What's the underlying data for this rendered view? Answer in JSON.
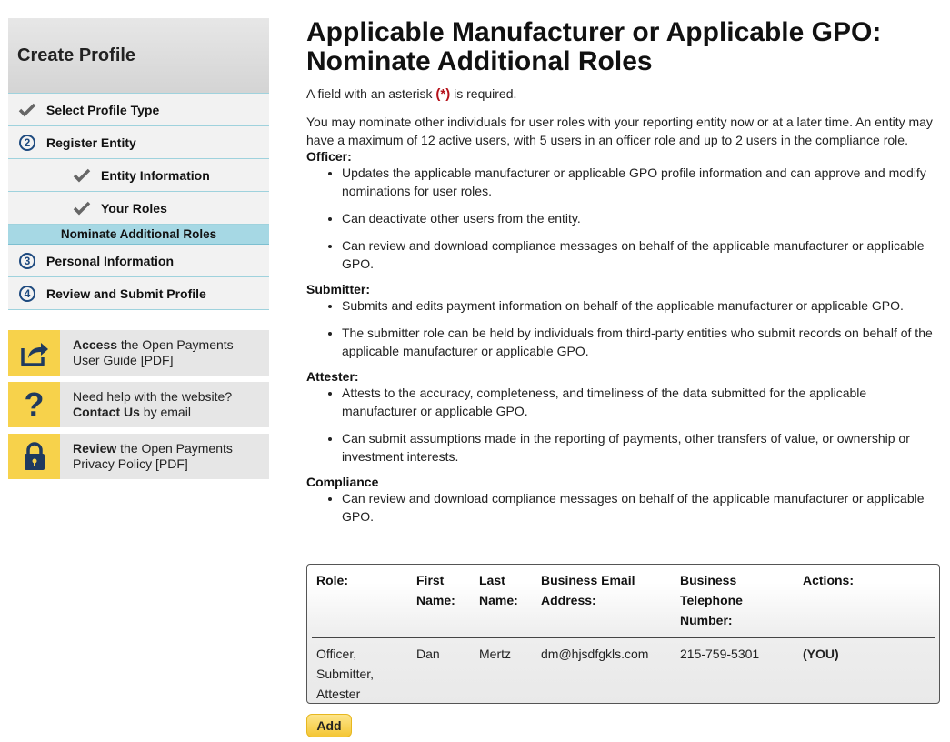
{
  "sidebar": {
    "title": "Create Profile",
    "steps": [
      {
        "label": "Select Profile Type"
      },
      {
        "label": "Register Entity",
        "number": "2"
      },
      {
        "label": "Entity Information"
      },
      {
        "label": "Your Roles"
      },
      {
        "label": "Nominate Additional Roles"
      },
      {
        "label": "Personal Information",
        "number": "3"
      },
      {
        "label": "Review and Submit Profile",
        "number": "4"
      }
    ],
    "help": [
      {
        "bold": "Access",
        "text1": " the Open Payments",
        "text2": "User Guide [PDF]",
        "icon": "share-icon"
      },
      {
        "line1": "Need help with the website?",
        "bold": "Contact Us",
        "text2": " by email",
        "icon": "question-icon"
      },
      {
        "bold": "Review",
        "text1": " the Open Payments",
        "text2": "Privacy Policy [PDF]",
        "icon": "lock-icon"
      }
    ]
  },
  "page": {
    "title": "Applicable Manufacturer or Applicable GPO: Nominate Additional Roles",
    "required_prefix": "A field with an asterisk ",
    "required_mark": "(*)",
    "required_suffix": " is required.",
    "intro": "You may nominate other individuals for user roles with your reporting entity now or at a later time. An entity may have a maximum of 12 active users, with 5 users in an officer role and up to 2 users in the compliance role."
  },
  "roles": [
    {
      "title": "Officer:",
      "items": [
        "Updates the applicable manufacturer or applicable GPO profile information and can approve and modify nominations for user roles.",
        "Can deactivate other users from the entity.",
        "Can review and download compliance messages on behalf of the applicable manufacturer or applicable GPO."
      ]
    },
    {
      "title": "Submitter:",
      "items": [
        "Submits and edits payment information on behalf of the applicable manufacturer or applicable GPO.",
        "The submitter role can be held by individuals from third-party entities who submit records on behalf of the applicable manufacturer or applicable GPO."
      ]
    },
    {
      "title": "Attester:",
      "items": [
        "Attests to the accuracy, completeness, and timeliness of the data submitted for the applicable manufacturer or applicable GPO.",
        "Can submit assumptions made in the reporting of payments, other transfers of value, or ownership or investment interests."
      ]
    },
    {
      "title": "Compliance",
      "items": [
        "Can review and download compliance messages on behalf of the applicable manufacturer or applicable GPO."
      ]
    }
  ],
  "table": {
    "headers": [
      "Role:",
      "First Name:",
      "Last Name:",
      "Business Email Address:",
      "Business Telephone Number:",
      "Actions:"
    ],
    "rows": [
      {
        "role": "Officer, Submitter, Attester",
        "first": "Dan",
        "last": "Mertz",
        "email": "dm@hjsdfgkls.com",
        "phone": "215-759-5301",
        "action": "(YOU)"
      }
    ]
  },
  "buttons": {
    "add": "Add"
  },
  "colors": {
    "accent_blue": "#1e4a7f",
    "current_step": "#a6d8e4",
    "icon_yellow": "#f7d24b",
    "required_red": "#b5121b"
  }
}
